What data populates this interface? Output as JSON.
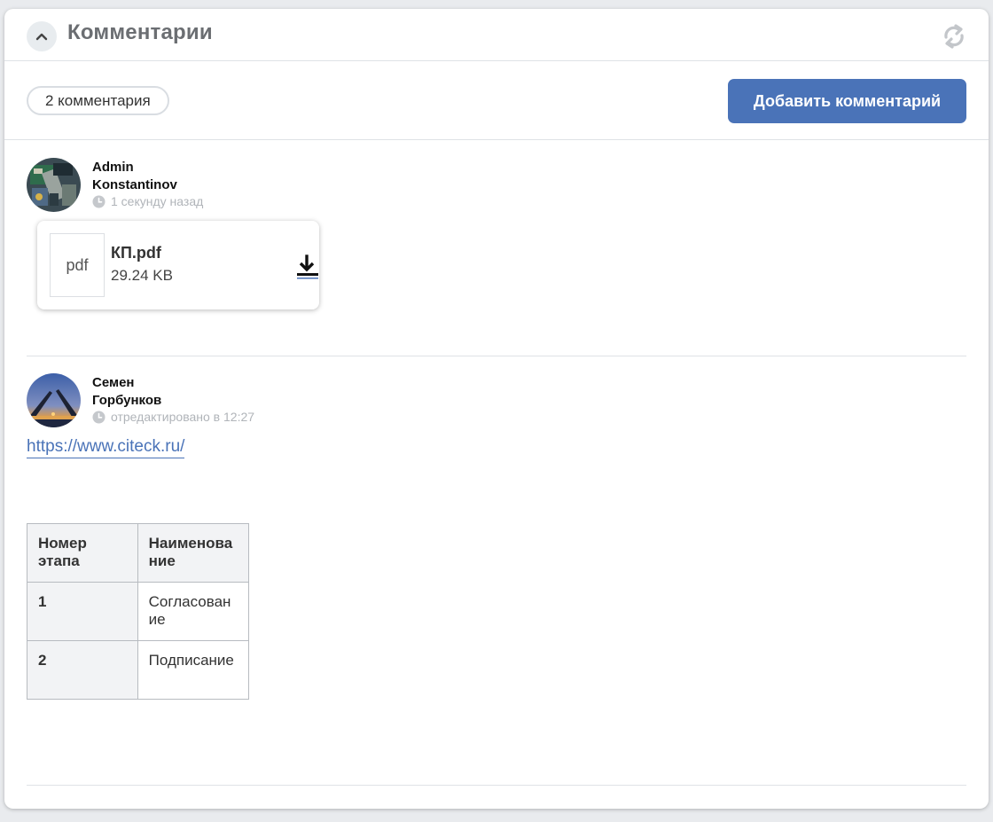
{
  "panel": {
    "title": "Комментарии"
  },
  "toolbar": {
    "count_label": "2 комментария",
    "add_button_label": "Добавить комментарий"
  },
  "icons": {
    "collapse": "chevron-up-icon",
    "refresh": "refresh-icon",
    "clock": "clock-icon",
    "download": "download-icon"
  },
  "colors": {
    "accent": "#4a73b8",
    "title": "#6b6e72",
    "muted": "#b0b4b9"
  },
  "comments": [
    {
      "author_first": "Admin",
      "author_last": "Konstantinov",
      "time": "1 секунду назад",
      "attachment": {
        "type_label": "pdf",
        "name": "КП.pdf",
        "size": "29.24 KB"
      }
    },
    {
      "author_first": "Семен",
      "author_last": "Горбунков",
      "time": "отредактировано в 12:27",
      "link": "https://www.citeck.ru/",
      "table": {
        "headers": [
          "Номер этапа",
          "Наименование"
        ],
        "rows": [
          [
            "1",
            "Согласование"
          ],
          [
            "2",
            "Подписание"
          ]
        ]
      }
    }
  ]
}
